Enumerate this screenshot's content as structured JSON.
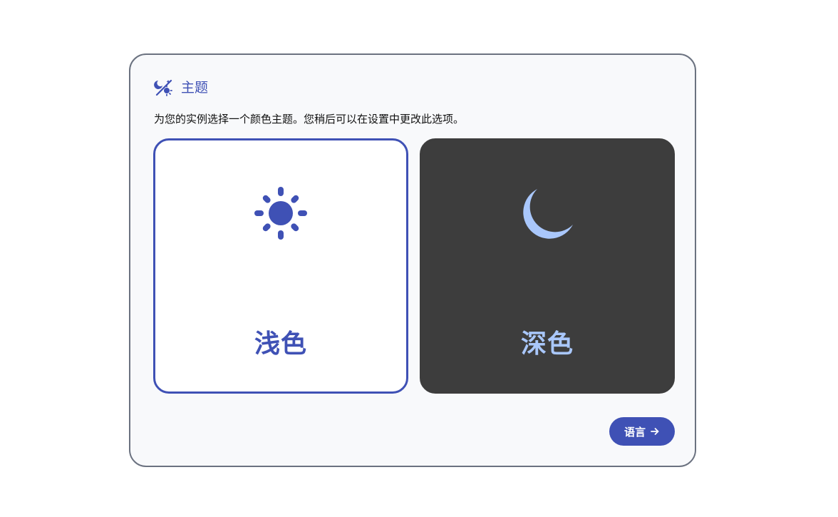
{
  "header": {
    "title": "主题",
    "icon": "theme-icon"
  },
  "description": "为您的实例选择一个颜色主题。您稍后可以在设置中更改此选项。",
  "options": [
    {
      "label": "浅色",
      "icon": "sun-icon",
      "selected": true
    },
    {
      "label": "深色",
      "icon": "moon-icon",
      "selected": false
    }
  ],
  "next_button": {
    "label": "语言",
    "icon": "arrow-right-icon"
  },
  "colors": {
    "accent": "#3f51b5",
    "dark_card": "#3d3d3d",
    "moon": "#a9c7fb",
    "card_border": "#6b7280",
    "card_bg": "#f8f9fb"
  }
}
